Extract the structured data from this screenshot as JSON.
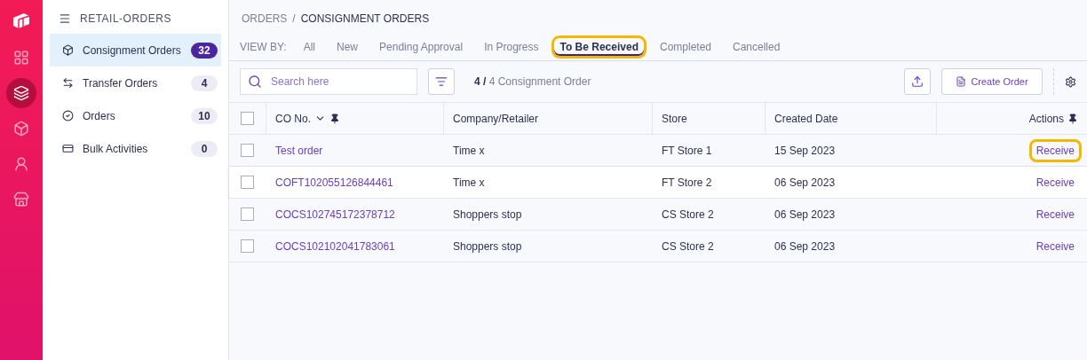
{
  "rail": {
    "items": [
      {
        "kind": "grid",
        "selected": false
      },
      {
        "kind": "layers",
        "selected": true
      },
      {
        "kind": "box",
        "selected": false
      },
      {
        "kind": "user",
        "selected": false
      },
      {
        "kind": "store",
        "selected": false
      }
    ]
  },
  "sidebar": {
    "title": "RETAIL-ORDERS",
    "items": [
      {
        "kind": "box",
        "label": "Consignment Orders",
        "count": "32",
        "selected": true
      },
      {
        "kind": "transfer",
        "label": "Transfer Orders",
        "count": "4",
        "selected": false
      },
      {
        "kind": "check",
        "label": "Orders",
        "count": "10",
        "selected": false
      },
      {
        "kind": "card",
        "label": "Bulk Activities",
        "count": "0",
        "selected": false
      }
    ]
  },
  "breadcrumb": {
    "parent": "ORDERS",
    "separator": "/",
    "current": "CONSIGNMENT ORDERS"
  },
  "view_by": {
    "label": "VIEW BY:",
    "tabs": [
      {
        "label": "All",
        "selected": false,
        "highlighted": false
      },
      {
        "label": "New",
        "selected": false,
        "highlighted": false
      },
      {
        "label": "Pending Approval",
        "selected": false,
        "highlighted": false
      },
      {
        "label": "In Progress",
        "selected": false,
        "highlighted": false
      },
      {
        "label": "To Be Received",
        "selected": true,
        "highlighted": true
      },
      {
        "label": "Completed",
        "selected": false,
        "highlighted": false
      },
      {
        "label": "Cancelled",
        "selected": false,
        "highlighted": false
      }
    ]
  },
  "toolbar": {
    "search": {
      "placeholder": "Search here"
    },
    "count_shown": "4 /",
    "count_total": "4 Consignment Order",
    "create_button": "Create Order"
  },
  "table": {
    "all_checked": false,
    "columns": [
      "CO No.",
      "Company/Retailer",
      "Store",
      "Created Date",
      "Actions"
    ],
    "rows": [
      {
        "co_no": "Test order",
        "company": "Time x",
        "store": "FT Store 1",
        "created": "15 Sep 2023",
        "action": "Receive",
        "checked": false,
        "hovered": false,
        "action_highlighted": true
      },
      {
        "co_no": "COFT102055126844461",
        "company": "Time x",
        "store": "FT Store 2",
        "created": "06 Sep 2023",
        "action": "Receive",
        "checked": false,
        "hovered": true,
        "action_highlighted": false
      },
      {
        "co_no": "COCS102745172378712",
        "company": "Shoppers stop",
        "store": "CS Store 2",
        "created": "06 Sep 2023",
        "action": "Receive",
        "checked": false,
        "hovered": false,
        "action_highlighted": false
      },
      {
        "co_no": "COCS102102041783061",
        "company": "Shoppers stop",
        "store": "CS Store 2",
        "created": "06 Sep 2023",
        "action": "Receive",
        "checked": false,
        "hovered": false,
        "action_highlighted": false
      }
    ]
  }
}
